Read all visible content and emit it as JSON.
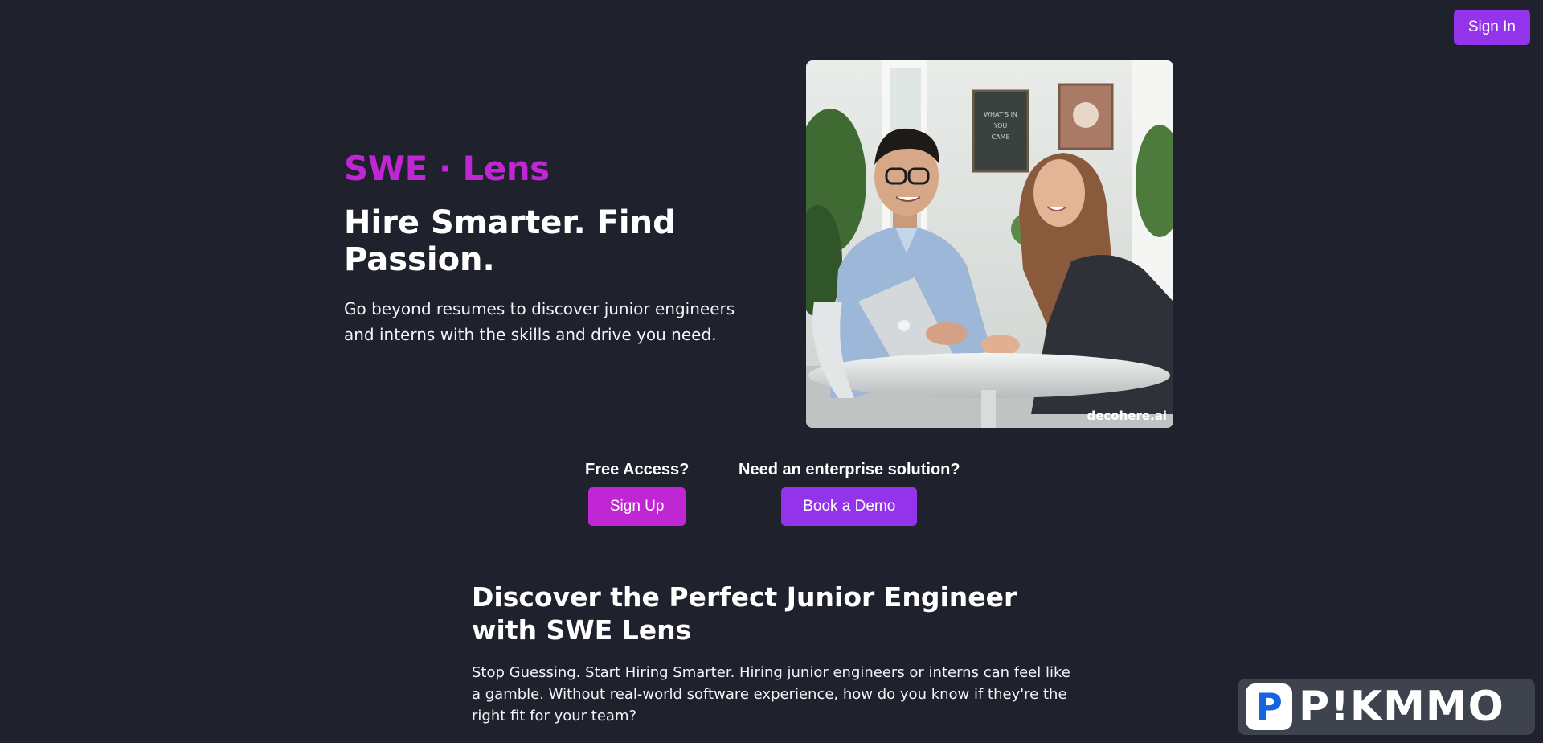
{
  "header": {
    "signin_label": "Sign In"
  },
  "hero": {
    "brand_left": "SWE",
    "brand_sep": "·",
    "brand_right": "Lens",
    "title": "Hire Smarter. Find Passion.",
    "subtitle": "Go beyond resumes to discover junior engineers and interns with the skills and drive you need.",
    "image_watermark": "decohere.ai",
    "poster_text": "WHAT'S IN YOU CAME"
  },
  "cta": {
    "free_label": "Free Access?",
    "signup_label": "Sign Up",
    "enterprise_label": "Need an enterprise solution?",
    "demo_label": "Book a Demo"
  },
  "section": {
    "title": "Discover the Perfect Junior Engineer with SWE Lens",
    "body": "Stop Guessing. Start Hiring Smarter. Hiring junior engineers or interns can feel like a gamble. Without real-world software experience, how do you know if they're the right fit for your team?"
  },
  "corner_logo": {
    "p": "P",
    "word": "P!KMMO"
  },
  "colors": {
    "background": "#1f222c",
    "brand_magenta": "#c026d3",
    "brand_purple": "#9333ea"
  }
}
